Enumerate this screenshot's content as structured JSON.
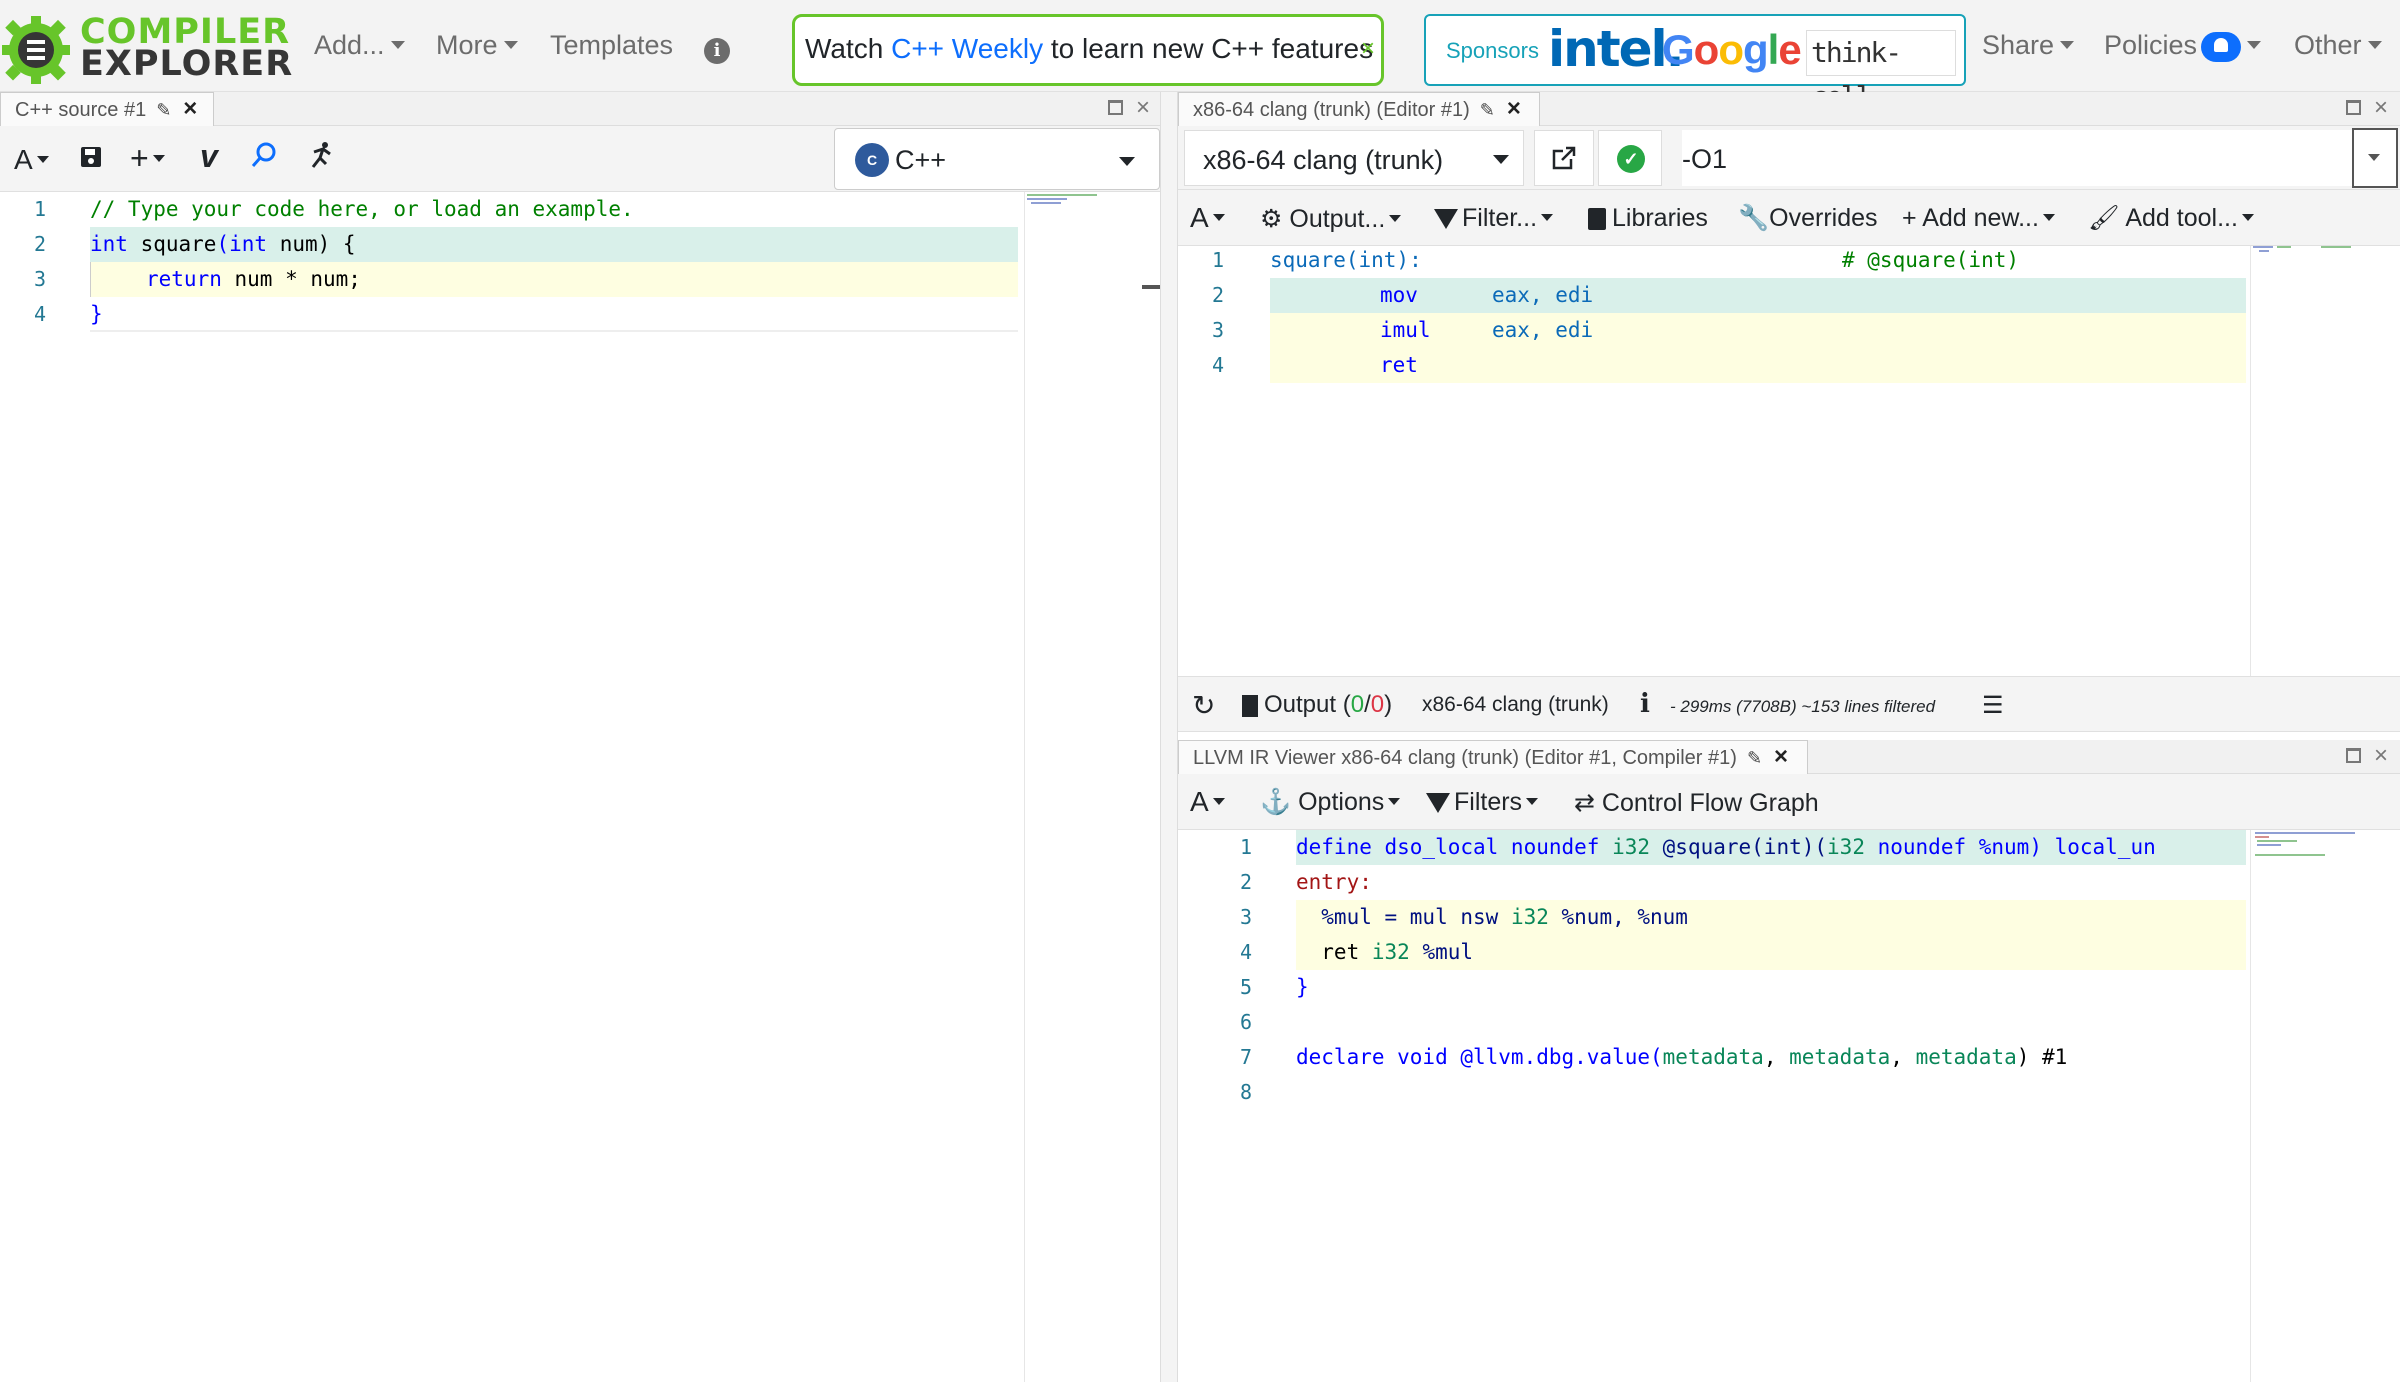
{
  "nav": {
    "logo_line1": "COMPILER",
    "logo_line2": "EXPLORER",
    "add": "Add...",
    "more": "More",
    "templates": "Templates",
    "banner_prefix": "Watch ",
    "banner_link": "C++ Weekly",
    "banner_suffix": " to learn new C++ features",
    "banner_close": "×",
    "sponsors_label": "Sponsors",
    "sponsor_intel": "intel.",
    "sponsor_google": "Google",
    "sponsor_thinkcell": "think-cell",
    "share": "Share",
    "policies": "Policies",
    "other": "Other"
  },
  "editor": {
    "tab_title": "C++ source #1",
    "language": "C++",
    "lines": [
      "1",
      "2",
      "3",
      "4"
    ],
    "code": {
      "l1": "// Type your code here, or load an example.",
      "l2_kw": "int",
      "l2_fn": " square",
      "l2_p1": "(",
      "l2_kw2": "int",
      "l2_rest": " num) {",
      "l3_kw": "return",
      "l3_rest": " num * num;",
      "l4": "}"
    }
  },
  "compiler": {
    "tab_title": "x86-64 clang (trunk) (Editor #1)",
    "name": "x86-64 clang (trunk)",
    "options": "-O1",
    "toolbar": {
      "font": "A",
      "output": "Output...",
      "filter": "Filter...",
      "libraries": "Libraries",
      "overrides": "Overrides",
      "add_new": "Add new...",
      "add_tool": "Add tool..."
    },
    "asm": {
      "l1_label": "square(int):",
      "l1_comment": "# @square(int)",
      "l2_ins": "mov",
      "l2_ops": "eax, edi",
      "l3_ins": "imul",
      "l3_ops": "eax, edi",
      "l4_ins": "ret"
    },
    "lines": [
      "1",
      "2",
      "3",
      "4"
    ],
    "status": {
      "output_label": "Output (",
      "output_ok": "0",
      "output_sep": "/",
      "output_err": "0",
      "output_close": ")",
      "compiler": "x86-64 clang (trunk)",
      "info": "i",
      "timing": "- 299ms (7708B) ~153 lines filtered"
    }
  },
  "ir": {
    "tab_title": "LLVM IR Viewer x86-64 clang (trunk) (Editor #1, Compiler #1)",
    "toolbar": {
      "font": "A",
      "options": "Options",
      "filters": "Filters",
      "cfg": "Control Flow Graph"
    },
    "lines": [
      "1",
      "2",
      "3",
      "4",
      "5",
      "6",
      "7",
      "8"
    ],
    "code": {
      "l1_a": "define dso_local noundef ",
      "l1_b": "i32",
      "l1_c": " @square(int)(",
      "l1_d": "i32",
      "l1_e": " noundef %num) local_un",
      "l2": "entry:",
      "l3_a": "  %mul = mul nsw ",
      "l3_b": "i32",
      "l3_c": " %num, %num",
      "l4_a": "  ret ",
      "l4_b": "i32",
      "l4_c": " %mul",
      "l5": "}",
      "l7_a": "declare void @llvm.dbg.value(",
      "l7_b": "metadata",
      "l7_c": ", ",
      "l7_d": "metadata",
      "l7_e": ", ",
      "l7_f": "metadata",
      "l7_g": ") #1"
    }
  }
}
